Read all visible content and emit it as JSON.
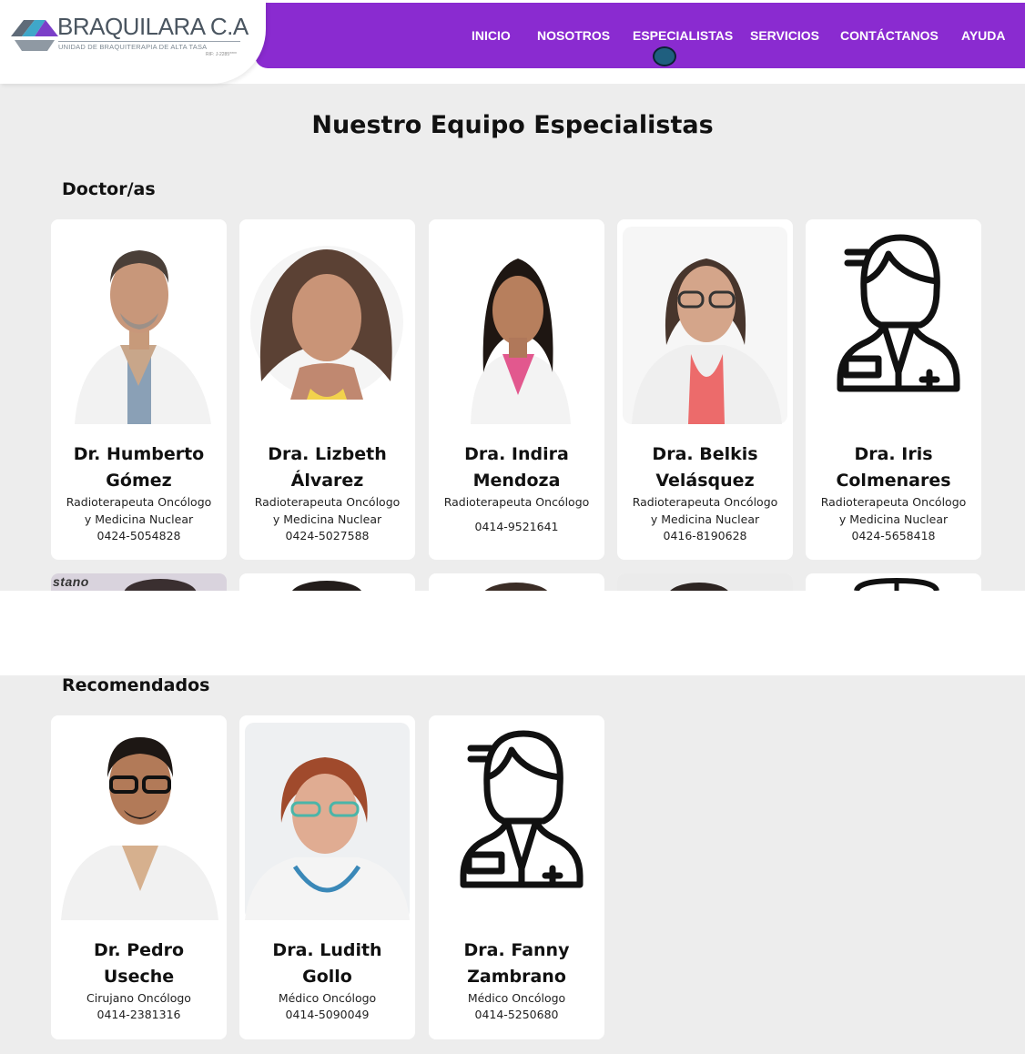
{
  "brand": {
    "name": "BRAQUILARA C.A",
    "tagline": "UNIDAD DE BRAQUITERAPIA DE ALTA TASA",
    "rif": "RIF: J-2285****",
    "colors": {
      "nav": "#8a2bd0",
      "page_bg": "#ededed",
      "card_bg": "#ffffff"
    }
  },
  "nav": {
    "items": [
      {
        "label": "INICIO"
      },
      {
        "label": "NOSOTROS"
      },
      {
        "label": "ESPECIALISTAS",
        "active": true
      },
      {
        "label": "SERVICIOS"
      },
      {
        "label": "CONTÁCTANOS"
      },
      {
        "label": "AYUDA"
      }
    ]
  },
  "page": {
    "title": "Nuestro Equipo Especialistas"
  },
  "doctors": {
    "title": "Doctor/as",
    "cards": [
      {
        "name_line1": "Dr. Humberto",
        "name_line2": "Gómez",
        "role_line1": "Radioterapeuta Oncólogo",
        "role_line2": "y Medicina Nuclear",
        "phone": "0424-5054828",
        "photo": "doctor-photo"
      },
      {
        "name_line1": "Dra. Lizbeth",
        "name_line2": "Álvarez",
        "role_line1": "Radioterapeuta Oncólogo",
        "role_line2": "y Medicina Nuclear",
        "phone": "0424-5027588",
        "photo": "doctor-photo"
      },
      {
        "name_line1": "Dra. Indira",
        "name_line2": "Mendoza",
        "role_line1": "Radioterapeuta Oncólogo",
        "role_line2": "",
        "phone": "0414-9521641",
        "photo": "doctor-photo"
      },
      {
        "name_line1": "Dra. Belkis",
        "name_line2": "Velásquez",
        "role_line1": "Radioterapeuta Oncólogo",
        "role_line2": "y Medicina Nuclear",
        "phone": "0416-8190628",
        "photo": "doctor-photo"
      },
      {
        "name_line1": "Dra. Iris",
        "name_line2": "Colmenares",
        "role_line1": "Radioterapeuta Oncólogo",
        "role_line2": "y Medicina Nuclear",
        "phone": "0424-5658418",
        "photo": "doctor-placeholder-icon"
      }
    ],
    "peek_text": "stano"
  },
  "recommended": {
    "title": "Recomendados",
    "cards": [
      {
        "name_line1": "Dr. Pedro",
        "name_line2": "Useche",
        "role_line1": "Cirujano Oncólogo",
        "phone": "0414-2381316",
        "photo": "doctor-photo"
      },
      {
        "name_line1": "Dra. Ludith",
        "name_line2": "Gollo",
        "role_line1": "Médico Oncólogo",
        "phone": "0414-5090049",
        "photo": "doctor-photo"
      },
      {
        "name_line1": "Dra. Fanny",
        "name_line2": "Zambrano",
        "role_line1": "Médico Oncólogo",
        "phone": "0414-5250680",
        "photo": "doctor-placeholder-icon"
      }
    ]
  }
}
